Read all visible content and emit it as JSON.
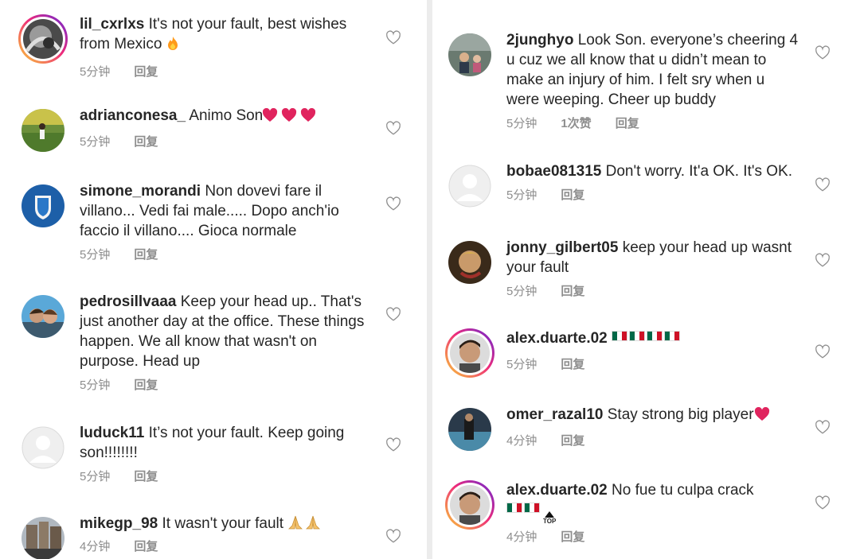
{
  "left": [
    {
      "username": "lil_cxrlxs",
      "text": "It's not your fault, best wishes from Mexico",
      "emoji": "fire",
      "time": "5分钟",
      "reply": "回复",
      "ring": true
    },
    {
      "username": "adrianconesa_",
      "text": "Animo Son",
      "emoji": "hearts3",
      "time": "5分钟",
      "reply": "回复",
      "ring": false
    },
    {
      "username": "simone_morandi",
      "text": "Non dovevi fare il villano... Vedi fai male..... Dopo anch'io faccio il villano.... Gioca normale",
      "time": "5分钟",
      "reply": "回复",
      "ring": false
    },
    {
      "username": "pedrosillvaaa",
      "text": "Keep your head up.. That's just another day at the office. These things happen. We all know that wasn't on purpose. Head up",
      "time": "5分钟",
      "reply": "回复",
      "ring": false
    },
    {
      "username": "luduck11",
      "text": "It’s not your fault. Keep going son!!!!!!!!",
      "time": "5分钟",
      "reply": "回复",
      "ring": false
    },
    {
      "username": "mikegp_98",
      "text": "It wasn't your fault",
      "emoji": "pray2",
      "time": "4分钟",
      "reply": "回复",
      "ring": false
    }
  ],
  "right": [
    {
      "username": "2junghyo",
      "text": "Look Son. everyone’s cheering 4 u cuz we all know that u didn’t mean to make an injury of him. I felt sry when u were weeping. Cheer up buddy",
      "time": "5分钟",
      "likes": "1次赞",
      "reply": "回复",
      "ring": false
    },
    {
      "username": "bobae081315",
      "text": "Don't worry. It'a OK. It's OK.",
      "time": "5分钟",
      "reply": "回复",
      "ring": false
    },
    {
      "username": "jonny_gilbert05",
      "text": "keep your head up wasnt your fault",
      "time": "5分钟",
      "reply": "回复",
      "ring": false
    },
    {
      "username": "alex.duarte.02",
      "text": "",
      "emoji": "flags4",
      "time": "5分钟",
      "reply": "回复",
      "ring": true
    },
    {
      "username": "omer_razal10",
      "text": "Stay strong big player",
      "emoji": "heart1",
      "time": "4分钟",
      "reply": "回复",
      "ring": false
    },
    {
      "username": "alex.duarte.02",
      "text": "No fue tu culpa crack",
      "emoji": "flags2top",
      "time": "4分钟",
      "reply": "回复",
      "ring": true
    }
  ],
  "top_badge": "TOP",
  "colors": {
    "text": "#262626",
    "meta": "#8e8e8e",
    "heart": "#8e8e8e",
    "ring_start": "#f9ce34",
    "ring_mid": "#ee2a7b",
    "ring_end": "#6228d7"
  },
  "icons": {
    "like": "heart-outline-icon",
    "avatar_default": "default-avatar-icon"
  }
}
